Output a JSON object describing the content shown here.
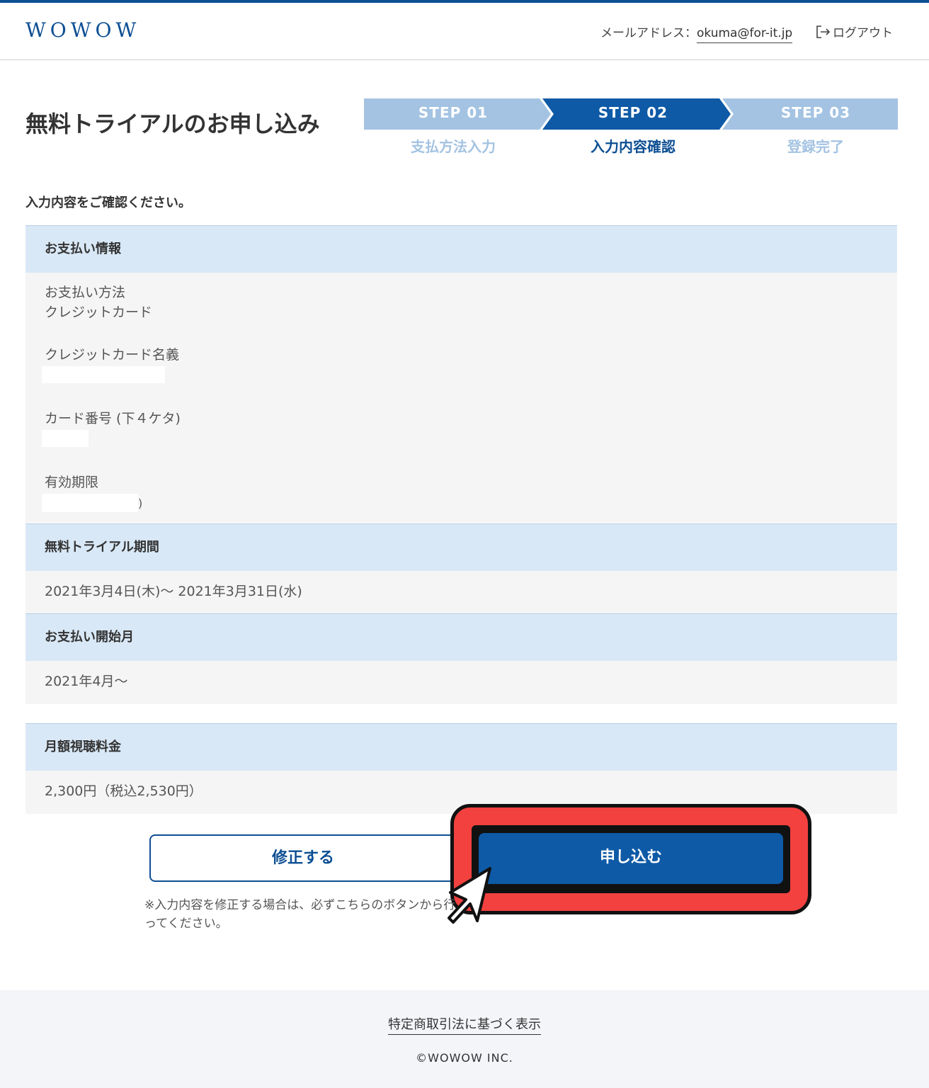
{
  "header": {
    "logo": "WOWOW",
    "email_label": "メールアドレス：",
    "email_value": "okuma@for-it.jp",
    "logout_label": "ログアウト"
  },
  "page": {
    "title": "無料トライアルのお申し込み",
    "instruction": "入力内容をご確認ください。"
  },
  "steps": [
    {
      "label": "STEP 01",
      "sub": "支払方法入力",
      "state": "done"
    },
    {
      "label": "STEP 02",
      "sub": "入力内容確認",
      "state": "current"
    },
    {
      "label": "STEP 03",
      "sub": "登録完了",
      "state": "upcoming"
    }
  ],
  "sections": {
    "payment": {
      "heading": "お支払い情報",
      "method_label": "お支払い方法",
      "method_value": "クレジットカード",
      "card_name_label": "クレジットカード名義",
      "card_number_label": "カード番号 (下４ケタ)",
      "expiry_label": "有効期限",
      "expiry_tail": ")"
    },
    "trial": {
      "heading": "無料トライアル期間",
      "value": "2021年3月4日(木)～ 2021年3月31日(水)"
    },
    "billing_start": {
      "heading": "お支払い開始月",
      "value": "2021年4月～"
    },
    "monthly_fee": {
      "heading": "月額視聴料金",
      "value": "2,300円（税込2,530円）"
    }
  },
  "buttons": {
    "fix": "修正する",
    "apply": "申し込む"
  },
  "note": "※入力内容を修正する場合は、必ずこちらのボタンから行ってください。",
  "footer": {
    "link": "特定商取引法に基づく表示",
    "copyright": "©WOWOW INC."
  },
  "colors": {
    "brand": "#0d4f93",
    "step_active": "#0e5aa6",
    "step_inactive": "#a4c3e2",
    "section_head": "#d9e8f6",
    "highlight": "#f2413f"
  }
}
